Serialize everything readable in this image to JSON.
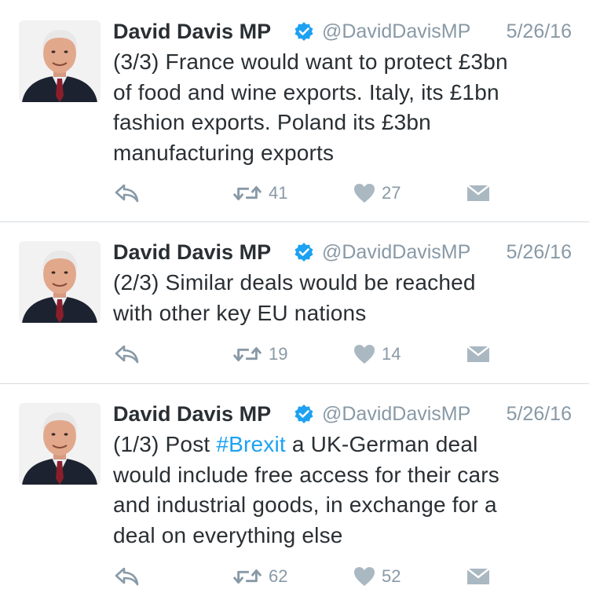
{
  "tweets": [
    {
      "name": "David Davis MP",
      "handle": "@DavidDavisMP",
      "date": "5/26/16",
      "text_lines": [
        "(3/3) France would want to protect £3bn",
        "of food and wine exports. Italy, its £1bn",
        "fashion exports. Poland its £3bn",
        "manufacturing exports"
      ],
      "retweets": "41",
      "likes": "27"
    },
    {
      "name": "David Davis MP",
      "handle": "@DavidDavisMP",
      "date": "5/26/16",
      "text_lines": [
        "(2/3) Similar deals would be reached",
        "with other key EU nations"
      ],
      "retweets": "19",
      "likes": "14"
    },
    {
      "name": "David Davis MP",
      "handle": "@DavidDavisMP",
      "date": "5/26/16",
      "text_first_prefix": "(1/3) Post ",
      "hashtag": "#Brexit",
      "text_first_suffix": " a UK-German deal",
      "text_lines": [
        "would include free access for their cars",
        "and industrial goods, in exchange for a",
        "deal on everything else"
      ],
      "retweets": "62",
      "likes": "52"
    }
  ],
  "icons": {
    "reply": "reply-icon",
    "retweet": "retweet-icon",
    "like": "heart-icon",
    "dm": "envelope-icon",
    "verified": "verified-badge-icon"
  },
  "colors": {
    "text": "#292f33",
    "muted": "#8899a6",
    "hashtag": "#1da1f2",
    "verified": "#1da1f2",
    "divider": "#d6dbe0"
  }
}
